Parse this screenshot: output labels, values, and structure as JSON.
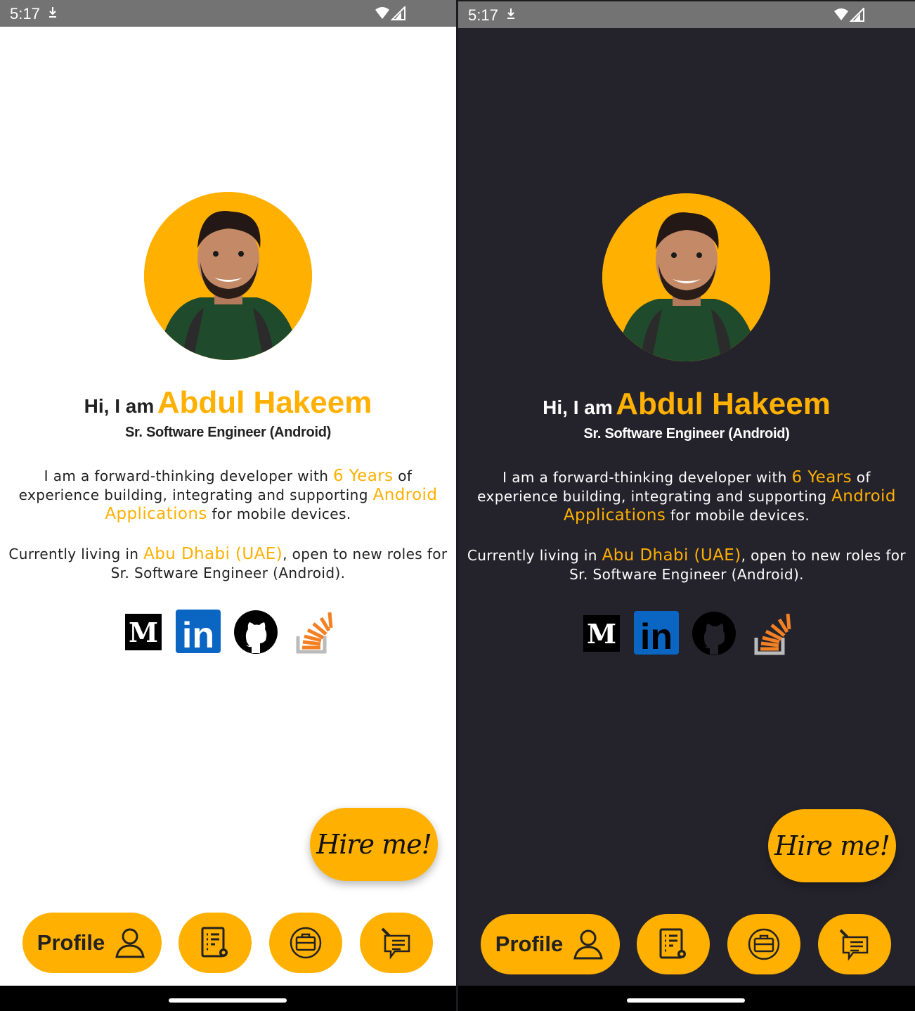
{
  "status": {
    "time": "5:17"
  },
  "profile": {
    "greeting": "Hi, I am",
    "name": "Abdul Hakeem",
    "role": "Sr. Software Engineer (Android)",
    "bio_part1": "I am a forward-thinking developer with",
    "bio_years": "6 Years",
    "bio_part2": "of experience building, integrating and supporting",
    "bio_apps": "Android Applications",
    "bio_part3": "for mobile devices.",
    "loc_part1": "Currently living in",
    "loc_city": "Abu Dhabi (UAE)",
    "loc_part2": ", open to new roles for Sr. Software Engineer (Android)."
  },
  "socials": [
    {
      "icon": "medium-icon",
      "letter": "M"
    },
    {
      "icon": "linkedin-icon",
      "letter": "in"
    },
    {
      "icon": "github-icon"
    },
    {
      "icon": "stackoverflow-icon"
    }
  ],
  "hire_label": "Hire me!",
  "nav": {
    "profile_label": "Profile",
    "items": [
      "user-icon",
      "resume-settings-icon",
      "briefcase-icon",
      "chat-edit-icon"
    ]
  },
  "colors": {
    "accent": "#ffb000",
    "dark_bg": "#24232c",
    "light_bg": "#ffffff"
  }
}
